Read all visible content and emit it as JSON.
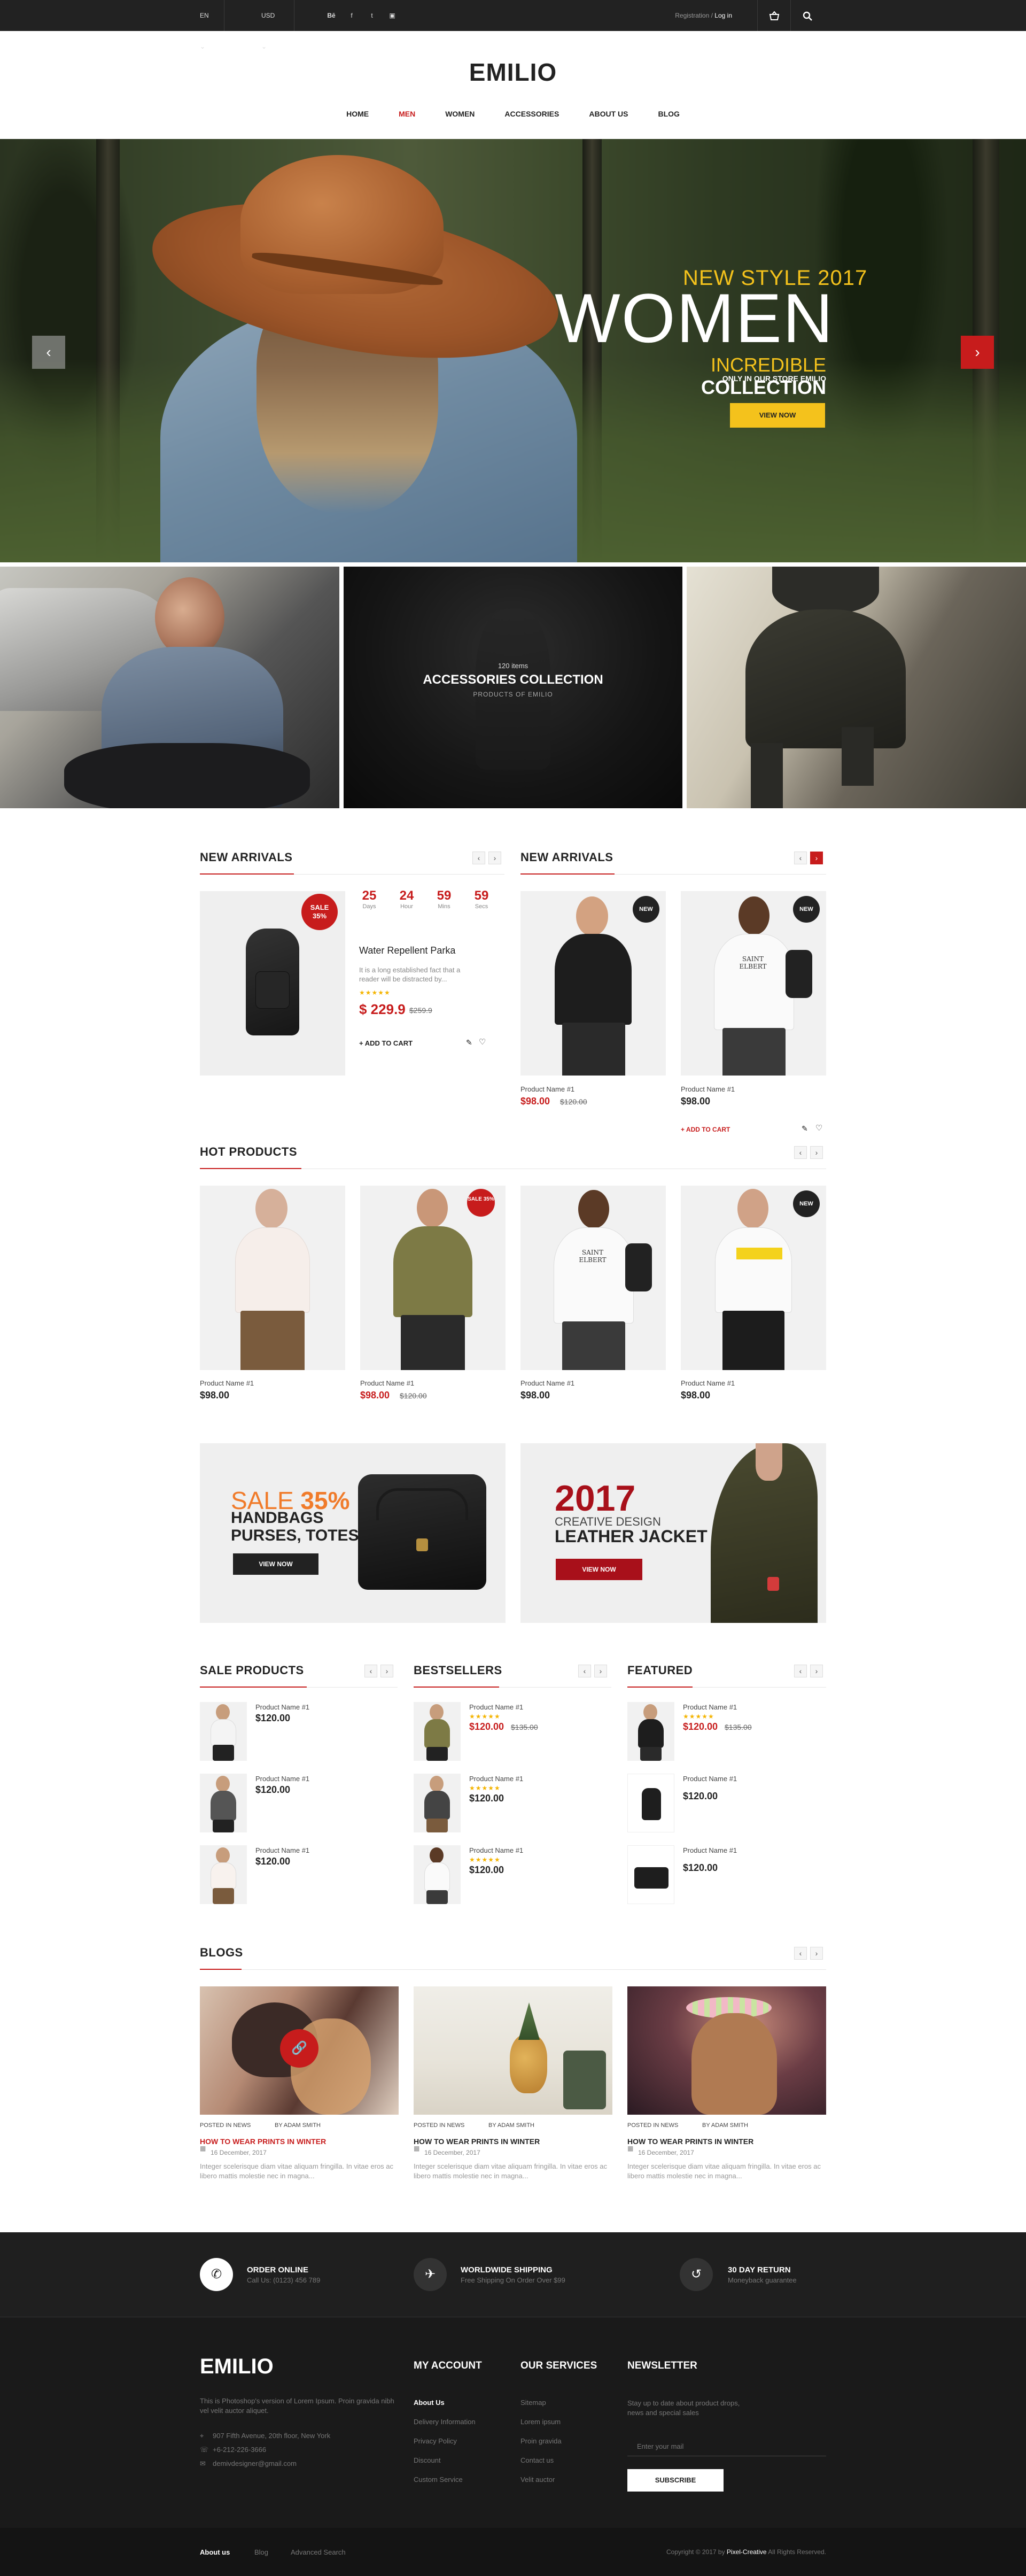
{
  "topbar": {
    "language": "EN",
    "currency": "USD",
    "social": [
      "Bē",
      "f",
      "t",
      "▣"
    ],
    "registration": "Registration",
    "separator": " / ",
    "login": "Log in"
  },
  "header": {
    "logo": "EMILIO",
    "nav": [
      "HOME",
      "MEN",
      "WOMEN",
      "ACCESSORIES",
      "ABOUT US",
      "BLOG"
    ],
    "active_nav": "MEN"
  },
  "hero": {
    "line1": "NEW STYLE 2017",
    "line2": "WOMEN",
    "line3_highlight": "INCREDIBLE",
    "line3_rest": " COLLECTION",
    "line4": "ONLY IN OUR STORE EMILIO",
    "button": "VIEW NOW",
    "accent_color": "#f4c21c"
  },
  "collection": {
    "count": "120 items",
    "title": "ACCESSORIES COLLECTION",
    "subtitle": "PRODUCTS OF EMILIO"
  },
  "new_arrivals_left": {
    "title": "NEW ARRIVALS",
    "badge_line1": "SALE",
    "badge_line2": "35%",
    "countdown": [
      {
        "value": "25",
        "label": "Days"
      },
      {
        "value": "24",
        "label": "Hour"
      },
      {
        "value": "59",
        "label": "Mins"
      },
      {
        "value": "59",
        "label": "Secs"
      }
    ],
    "product_name": "Water Repellent Parka",
    "description": "It is a long established fact that a reader will be distracted by...",
    "price": "$ 229.9",
    "old_price": "$259.9",
    "add_to_cart": "+ ADD TO CART"
  },
  "new_arrivals_right": {
    "title": "NEW ARRIVALS",
    "products": [
      {
        "name": "Product Name #1",
        "price": "$98.00",
        "old_price": "$120.00",
        "badge": "NEW"
      },
      {
        "name": "Product Name #1",
        "price": "$98.00",
        "old_price": "",
        "badge": "NEW"
      }
    ],
    "add_to_cart": "+ ADD TO CART"
  },
  "hot_products": {
    "title": "HOT PRODUCTS",
    "products": [
      {
        "name": "Product Name #1",
        "price": "$98.00",
        "old_price": "",
        "badge": ""
      },
      {
        "name": "Product Name #1",
        "price": "$98.00",
        "old_price": "$120.00",
        "badge": "SALE 35%"
      },
      {
        "name": "Product Name #1",
        "price": "$98.00",
        "old_price": "",
        "badge": ""
      },
      {
        "name": "Product Name #1",
        "price": "$98.00",
        "old_price": "",
        "badge": "NEW"
      }
    ]
  },
  "banners": {
    "left": {
      "sale": "SALE",
      "percent": "35%",
      "line2": "HANDBAGS",
      "line3": "PURSES, TOTES",
      "button": "VIEW NOW"
    },
    "right": {
      "year": "2017",
      "line2": "CREATIVE DESIGN",
      "line3": "LEATHER JACKET",
      "button": "VIEW NOW"
    }
  },
  "lists": {
    "sale": {
      "title": "SALE PRODUCTS",
      "items": [
        {
          "name": "Product Name #1",
          "price": "$120.00"
        },
        {
          "name": "Product Name #1",
          "price": "$120.00"
        },
        {
          "name": "Product Name #1",
          "price": "$120.00"
        }
      ]
    },
    "bestsellers": {
      "title": "BESTSELLERS",
      "items": [
        {
          "name": "Product Name #1",
          "stars": "★★★★★",
          "price": "$120.00",
          "old_price": "$135.00"
        },
        {
          "name": "Product Name #1",
          "stars": "★★★★★",
          "price": "$120.00",
          "old_price": ""
        },
        {
          "name": "Product Name #1",
          "stars": "★★★★★",
          "price": "$120.00",
          "old_price": ""
        }
      ]
    },
    "featured": {
      "title": "FEATURED",
      "items": [
        {
          "name": "Product Name #1",
          "stars": "★★★★★",
          "price": "$120.00",
          "old_price": "$135.00"
        },
        {
          "name": "Product Name #1",
          "stars": "",
          "price": "$120.00",
          "old_price": ""
        },
        {
          "name": "Product Name #1",
          "stars": "",
          "price": "$120.00",
          "old_price": ""
        }
      ]
    }
  },
  "blogs": {
    "title": "BLOGS",
    "posts": [
      {
        "category": "POSTED IN NEWS",
        "author": "BY ADAM SMITH",
        "title": "HOW TO WEAR PRINTS IN WINTER",
        "date": "16 December, 2017",
        "excerpt": "Integer scelerisque diam vitae aliquam fringilla. In vitae eros ac libero mattis molestie nec in magna..."
      },
      {
        "category": "POSTED IN NEWS",
        "author": "BY ADAM SMITH",
        "title": "HOW TO WEAR PRINTS IN WINTER",
        "date": "16 December, 2017",
        "excerpt": "Integer scelerisque diam vitae aliquam fringilla. In vitae eros ac libero mattis molestie nec in magna..."
      },
      {
        "category": "POSTED IN NEWS",
        "author": "BY ADAM SMITH",
        "title": "HOW TO WEAR PRINTS IN WINTER",
        "date": "16 December, 2017",
        "excerpt": "Integer scelerisque diam vitae aliquam fringilla. In vitae eros ac libero mattis molestie nec in magna..."
      }
    ]
  },
  "services": [
    {
      "title": "ORDER ONLINE",
      "subtitle": "Call Us: (0123) 456 789"
    },
    {
      "title": "WORLDWIDE SHIPPING",
      "subtitle": "Free Shipping On Order Over $99"
    },
    {
      "title": "30 DAY RETURN",
      "subtitle": "Moneyback guarantee"
    }
  ],
  "footer": {
    "logo": "EMILIO",
    "about": "This is Photoshop's version of Lorem Ipsum. Proin gravida nibh vel velit auctor aliquet.",
    "address": "907 Fifth Avenue, 20th floor, New York",
    "phone": "+6-212-226-3666",
    "email": "demivdesigner@gmail.com",
    "account": {
      "title": "MY ACCOUNT",
      "links": [
        "About Us",
        "Delivery Information",
        "Privacy Policy",
        "Discount",
        "Custom Service"
      ]
    },
    "services": {
      "title": "OUR SERVICES",
      "links": [
        "Sitemap",
        "Lorem ipsum",
        "Proin gravida",
        "Contact us",
        "Velit auctor"
      ]
    },
    "newsletter": {
      "title": "NEWSLETTER",
      "text": "Stay up to date about product drops, news and special sales",
      "placeholder": "Enter your mail",
      "button": "SUBSCRIBE"
    }
  },
  "bottom": {
    "links": [
      "About us",
      "Blog",
      "Advanced Search"
    ],
    "copyright_prefix": "Copyright © 2017 by ",
    "copyright_brand": "Pixel-Creative",
    "copyright_suffix": " All Rights Reserved."
  }
}
